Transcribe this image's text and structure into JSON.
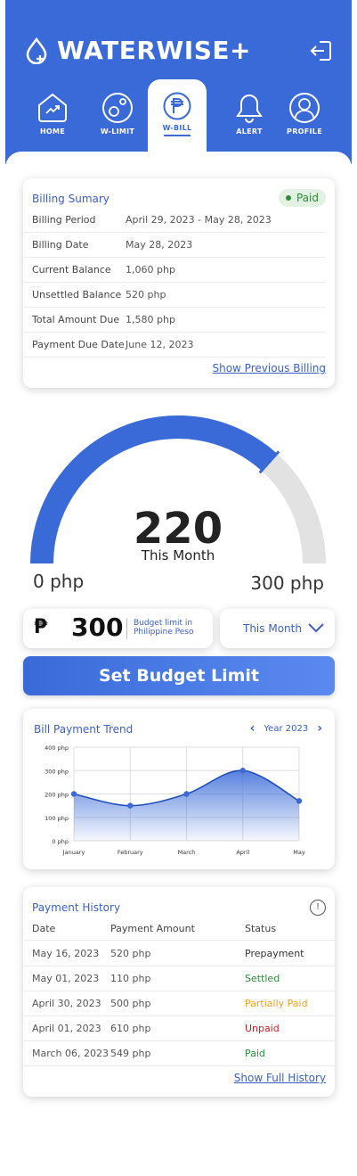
{
  "app": {
    "title": "WATERWISE+"
  },
  "nav": [
    {
      "label": "HOME",
      "icon": "home-chart-icon"
    },
    {
      "label": "W-LIMIT",
      "icon": "water-limit-icon"
    },
    {
      "label": "W-BILL",
      "icon": "peso-icon"
    },
    {
      "label": "ALERT",
      "icon": "bell-icon"
    },
    {
      "label": "PROFILE",
      "icon": "user-icon"
    }
  ],
  "billing": {
    "title": "Billing Sumary",
    "status": "Paid",
    "rows": [
      {
        "k": "Billing Period",
        "v": "April 29, 2023 - May 28, 2023"
      },
      {
        "k": "Billing Date",
        "v": "May 28, 2023"
      },
      {
        "k": "Current Balance",
        "v": "1,060 php"
      },
      {
        "k": "Unsettled Balance",
        "v": "520 php"
      },
      {
        "k": "Total Amount Due",
        "v": "1,580 php"
      },
      {
        "k": "Payment Due Date",
        "v": "June 12, 2023"
      }
    ],
    "link": "Show Previous Billing"
  },
  "gauge": {
    "value": "220",
    "caption": "This Month",
    "min_label": "0 php",
    "max_label": "300 php",
    "current": 220,
    "max": 300
  },
  "budget": {
    "symbol": "₱",
    "amount": "300",
    "note": "Budget limit in Philippine Peso",
    "period": "This Month",
    "button": "Set Budget Limit"
  },
  "chart_data": {
    "type": "area",
    "title": "Bill Payment Trend",
    "year_label": "Year 2023",
    "categories": [
      "January",
      "February",
      "March",
      "April",
      "May"
    ],
    "yticks": [
      "0 php",
      "100 php",
      "200 php",
      "300 php",
      "400 php"
    ],
    "ylim": [
      0,
      400
    ],
    "series": [
      {
        "values": [
          200,
          150,
          200,
          300,
          170
        ]
      }
    ],
    "grid": true
  },
  "history": {
    "title": "Payment History",
    "headers": [
      "Date",
      "Payment Amount",
      "Status"
    ],
    "rows": [
      {
        "date": "May 16, 2023",
        "amount": "520 php",
        "status": "Prepayment",
        "color": "#333333"
      },
      {
        "date": "May 01, 2023",
        "amount": "110 php",
        "status": "Settled",
        "color": "#2e8b3a"
      },
      {
        "date": "April 30, 2023",
        "amount": "500 php",
        "status": "Partially Paid",
        "color": "#f0a020"
      },
      {
        "date": "April 01, 2023",
        "amount": "610 php",
        "status": "Unpaid",
        "color": "#d02020"
      },
      {
        "date": "March 06, 2023",
        "amount": "549 php",
        "status": "Paid",
        "color": "#2e8b3a"
      }
    ],
    "link": "Show Full History"
  },
  "colors": {
    "primary": "#3a6ad8",
    "accent": "#3a5fc8",
    "track": "#e2e2e2"
  }
}
